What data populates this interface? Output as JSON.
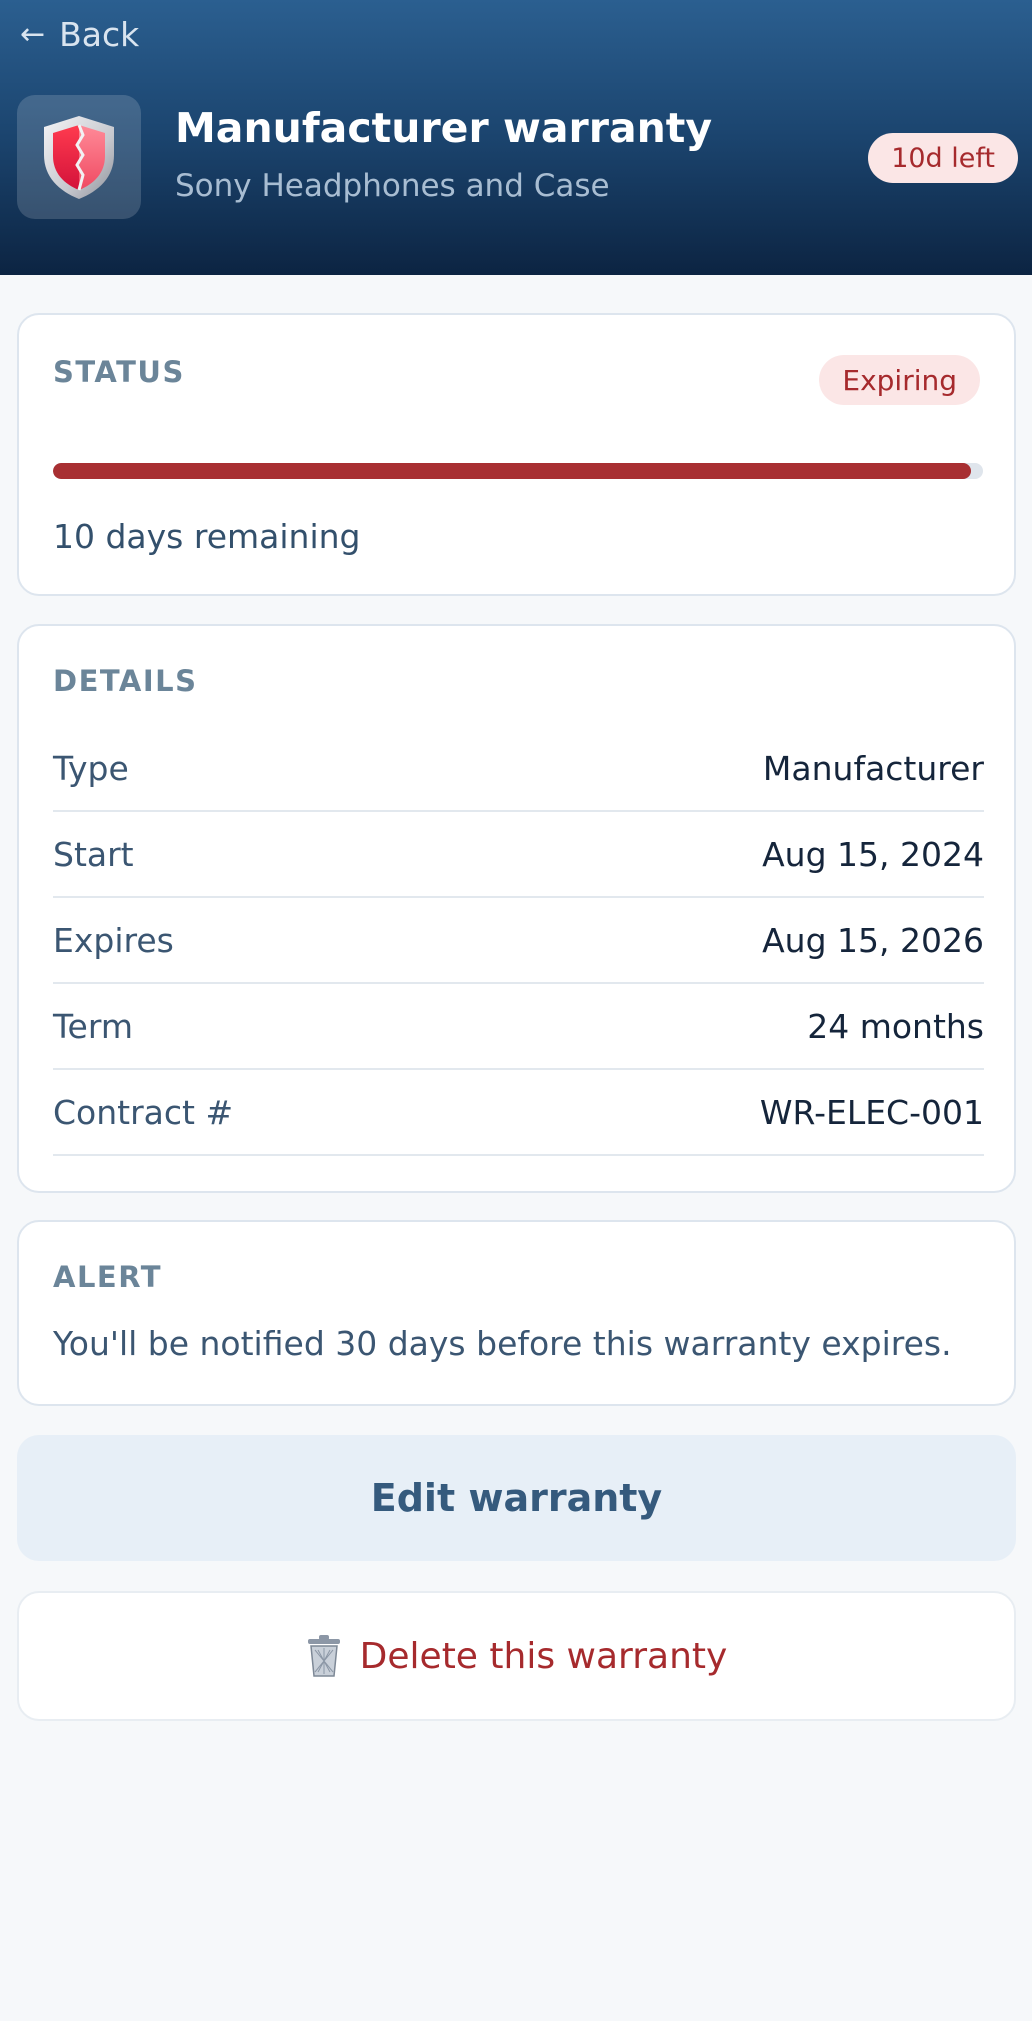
{
  "header": {
    "back_label": "Back",
    "back_arrow": "←",
    "icon": "shield-icon",
    "title": "Manufacturer warranty",
    "subtitle": "Sony Headphones and Case",
    "days_left_badge": "10d left"
  },
  "status": {
    "label": "STATUS",
    "badge": "Expiring",
    "progress_percent": 98.7,
    "remaining_text": "10 days remaining",
    "accent_color": "#a82f32"
  },
  "details": {
    "label": "DETAILS",
    "rows": [
      {
        "key": "Type",
        "value": "Manufacturer"
      },
      {
        "key": "Start",
        "value": "Aug 15, 2024"
      },
      {
        "key": "Expires",
        "value": "Aug 15, 2026"
      },
      {
        "key": "Term",
        "value": "24 months"
      },
      {
        "key": "Contract #",
        "value": "WR-ELEC-001"
      }
    ]
  },
  "alert": {
    "label": "ALERT",
    "text": "You'll be notified 30 days before this warranty expires."
  },
  "actions": {
    "edit_label": "Edit warranty",
    "delete_label": "Delete this warranty",
    "delete_icon": "trash-icon"
  }
}
